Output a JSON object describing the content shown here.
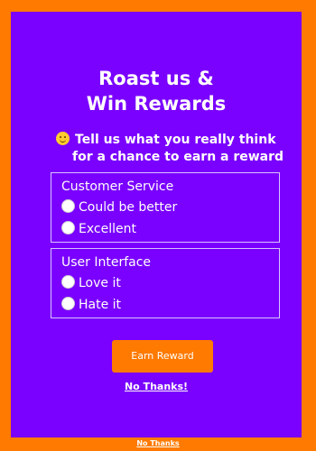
{
  "popup": {
    "title_line1": "Roast us &",
    "title_line2": "Win Rewards",
    "subtitle_line1": "Tell us what you really think",
    "subtitle_line2": "for a chance to earn a reward",
    "emoji_icon": "smiling-face-icon",
    "questions": [
      {
        "label": "Customer Service",
        "options": [
          "Could be better",
          "Excellent"
        ]
      },
      {
        "label": "User Interface",
        "options": [
          "Love it",
          "Hate it"
        ]
      }
    ],
    "earn_button_label": "Earn Reward",
    "no_thanks_label": "No Thanks!"
  },
  "footer": {
    "no_thanks_label": "No Thanks"
  },
  "colors": {
    "background_orange": "#ff7a00",
    "panel_purple": "#7a00ff",
    "button_orange": "#ff7a00",
    "text": "#ffffff"
  }
}
